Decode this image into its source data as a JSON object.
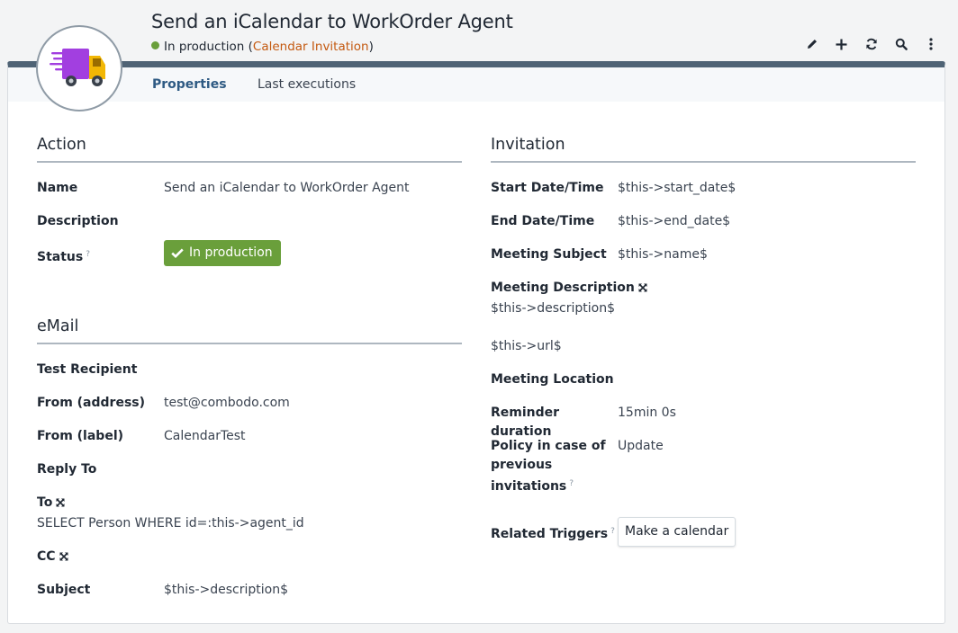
{
  "header": {
    "title": "Send an iCalendar to WorkOrder Agent",
    "status": "In production",
    "paren_open": "(",
    "class_name": "Calendar Invitation",
    "paren_close": ")"
  },
  "toolbar": {
    "icons": [
      "pencil-icon",
      "plus-icon",
      "refresh-icon",
      "search-icon",
      "more-icon"
    ]
  },
  "tabs": [
    {
      "label": "Properties",
      "active": true
    },
    {
      "label": "Last executions",
      "active": false
    }
  ],
  "action": {
    "title": "Action",
    "name_label": "Name",
    "name_value": "Send an iCalendar to WorkOrder Agent",
    "description_label": "Description",
    "status_label": "Status",
    "status_help": "?",
    "status_value": "In production"
  },
  "email": {
    "title": "eMail",
    "test_recipient_label": "Test Recipient",
    "from_address_label": "From (address)",
    "from_address_value": "test@combodo.com",
    "from_label_label": "From (label)",
    "from_label_value": "CalendarTest",
    "reply_to_label": "Reply To",
    "to_label": "To",
    "to_value": "SELECT Person WHERE id=:this->agent_id",
    "cc_label": "CC",
    "subject_label": "Subject",
    "subject_value": "$this->description$"
  },
  "invitation": {
    "title": "Invitation",
    "start_label": "Start Date/Time",
    "start_value": "$this->start_date$",
    "end_label": "End Date/Time",
    "end_value": "$this->end_date$",
    "subject_label": "Meeting Subject",
    "subject_value": "$this->name$",
    "description_label": "Meeting Description",
    "description_line1": "$this->description$",
    "description_line2": "$this->url$",
    "location_label": "Meeting Location",
    "reminder_label": "Reminder duration",
    "reminder_value": "15min 0s",
    "policy_label_1": "Policy in case of",
    "policy_label_2": "previous",
    "policy_label_3": "invitations",
    "policy_help": "?",
    "policy_value": "Update",
    "triggers_label": "Related Triggers",
    "triggers_help": "?",
    "trigger_button": "Make a calendar"
  },
  "colors": {
    "accent": "#2e5a83",
    "status_green": "#6a9f3b",
    "link_orange": "#c45a11",
    "card_top_bar": "#4f6375"
  }
}
